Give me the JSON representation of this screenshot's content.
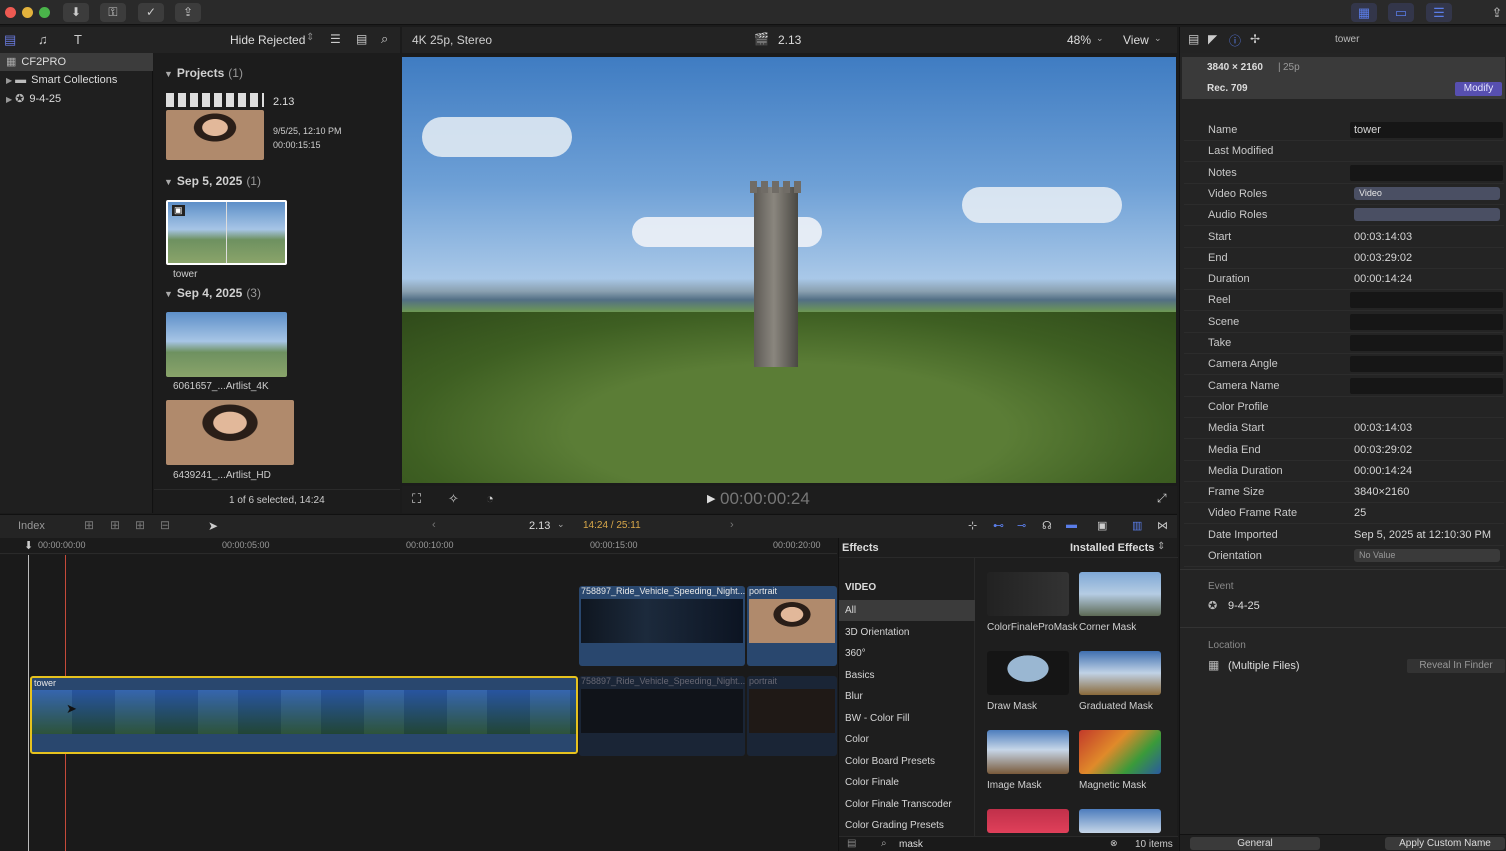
{
  "toolbar": {
    "buttons": [
      "download-icon",
      "key-icon",
      "check-icon",
      "share-icon"
    ],
    "right_buttons": [
      "grid-icon",
      "timeline-icon",
      "sliders-icon",
      "share-out-icon"
    ]
  },
  "library": {
    "filter": "Hide Rejected",
    "items": [
      {
        "label": "CF2PRO"
      },
      {
        "label": "Smart Collections"
      },
      {
        "label": "9-4-25"
      }
    ]
  },
  "browser": {
    "projects": {
      "title": "Projects",
      "count": "(1)",
      "item": {
        "name": "2.13",
        "date": "9/5/25, 12:10 PM",
        "duration": "00:00:15:15"
      }
    },
    "sections": [
      {
        "title": "Sep 5, 2025",
        "count": "(1)",
        "items": [
          "tower"
        ]
      },
      {
        "title": "Sep 4, 2025",
        "count": "(3)",
        "items": [
          "6061657_...Artlist_4K",
          "6439241_...Artlist_HD"
        ]
      }
    ],
    "status": "1 of 6 selected, 14:24"
  },
  "viewer": {
    "format": "4K 25p, Stereo",
    "project": "2.13",
    "zoom": "48%",
    "view": "View",
    "timecode": "00:00:00:24"
  },
  "inspector": {
    "clip_name": "tower",
    "resolution": "3840 × 2160",
    "fps": "25p",
    "colorspace": "Rec. 709",
    "modify": "Modify",
    "rows": [
      {
        "label": "Name",
        "value": "tower"
      },
      {
        "label": "Last Modified",
        "value": ""
      },
      {
        "label": "Notes",
        "value": ""
      },
      {
        "label": "Video Roles",
        "value": "Video"
      },
      {
        "label": "Audio Roles",
        "value": ""
      },
      {
        "label": "Start",
        "value": "00:03:14:03"
      },
      {
        "label": "End",
        "value": "00:03:29:02"
      },
      {
        "label": "Duration",
        "value": "00:00:14:24"
      },
      {
        "label": "Reel",
        "value": ""
      },
      {
        "label": "Scene",
        "value": ""
      },
      {
        "label": "Take",
        "value": ""
      },
      {
        "label": "Camera Angle",
        "value": ""
      },
      {
        "label": "Camera Name",
        "value": ""
      },
      {
        "label": "Color Profile",
        "value": ""
      },
      {
        "label": "Media Start",
        "value": "00:03:14:03"
      },
      {
        "label": "Media End",
        "value": "00:03:29:02"
      },
      {
        "label": "Media Duration",
        "value": "00:00:14:24"
      },
      {
        "label": "Frame Size",
        "value": "3840×2160"
      },
      {
        "label": "Video Frame Rate",
        "value": "25"
      },
      {
        "label": "Date Imported",
        "value": "Sep 5, 2025 at 12:10:30 PM"
      },
      {
        "label": "Orientation",
        "value": "No Value"
      }
    ],
    "event_label": "Event",
    "event_value": "9-4-25",
    "location_label": "Location",
    "location_value": "(Multiple Files)",
    "reveal": "Reveal In Finder",
    "general": "General",
    "apply_custom": "Apply Custom Name"
  },
  "timeline": {
    "index": "Index",
    "project": "2.13",
    "position": "14:24 / 25:11",
    "ruler": [
      "00:00:00:00",
      "00:00:05:00",
      "00:00:10:00",
      "00:00:15:00",
      "00:00:20:00"
    ],
    "clips": {
      "main": "tower",
      "upper1": "758897_Ride_Vehicle_Speeding_Night...",
      "upper2": "portrait",
      "lower1": "758897_Ride_Vehicle_Speeding_Night...",
      "lower2": "portrait"
    }
  },
  "effects": {
    "title": "Effects",
    "installed": "Installed Effects",
    "video_header": "VIDEO",
    "categories": [
      "All",
      "3D Orientation",
      "360°",
      "Basics",
      "Blur",
      "BW - Color Fill",
      "Color",
      "Color Board Presets",
      "Color Finale",
      "Color Finale Transcoder",
      "Color Grading Presets"
    ],
    "items": [
      "ColorFinaleProMask",
      "Corner Mask",
      "Draw Mask",
      "Graduated Mask",
      "Image Mask",
      "Magnetic Mask"
    ],
    "search": "mask",
    "count": "10 items"
  }
}
